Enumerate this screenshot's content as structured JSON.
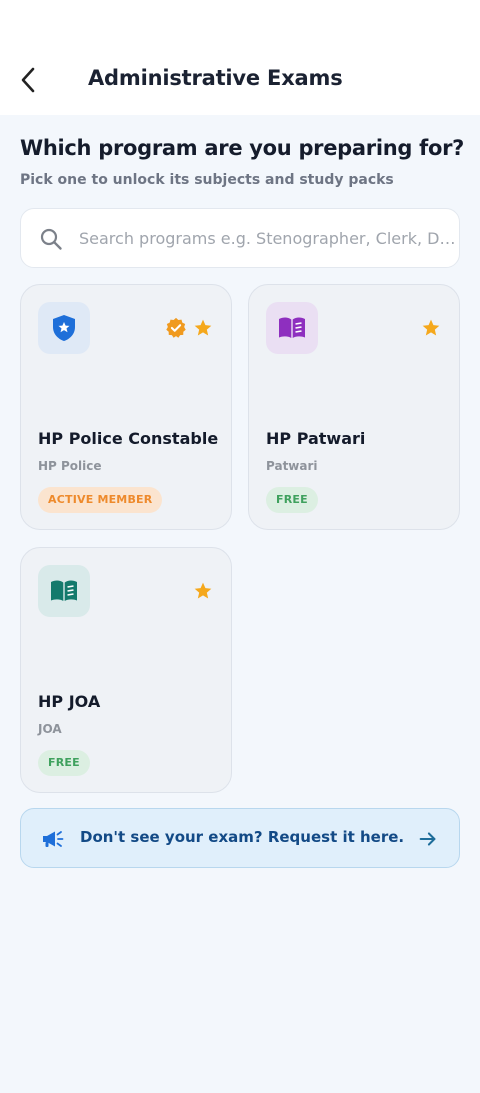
{
  "header": {
    "back_icon": "chevron-left-icon",
    "title": "Administrative Exams"
  },
  "intro": {
    "heading": "Which program are you preparing for?",
    "subheading": "Pick one to unlock its subjects and study packs"
  },
  "search": {
    "icon": "search-icon",
    "placeholder": "Search programs e.g. Stenographer, Clerk, Dr...",
    "value": ""
  },
  "programs": [
    {
      "title": "HP Police Constable",
      "category": "HP Police",
      "badge": "ACTIVE MEMBER",
      "badge_type": "active",
      "icon": "shield-star-icon",
      "icon_color": "#1e6fd9",
      "icon_bg": "#dfe9f6",
      "verified": true,
      "starred": true
    },
    {
      "title": "HP Patwari",
      "category": "Patwari",
      "badge": "FREE",
      "badge_type": "free",
      "icon": "book-open-icon",
      "icon_color": "#8e2fbf",
      "icon_bg": "#eadff3",
      "verified": false,
      "starred": true
    },
    {
      "title": "HP JOA",
      "category": "JOA",
      "badge": "FREE",
      "badge_type": "free",
      "icon": "book-open-icon",
      "icon_color": "#137a6c",
      "icon_bg": "#d9eaea",
      "verified": false,
      "starred": true
    }
  ],
  "request": {
    "icon": "megaphone-icon",
    "text": "Don't see your exam? Request it here.",
    "arrow_icon": "arrow-right-icon"
  },
  "colors": {
    "star": "#f5a81c",
    "verified": "#f09a1f",
    "accent": "#134a86"
  }
}
